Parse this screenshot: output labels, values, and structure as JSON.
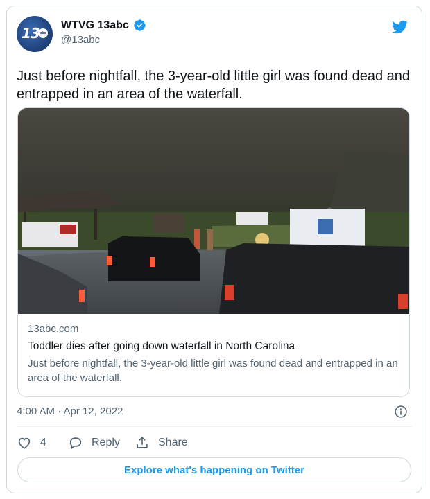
{
  "author": {
    "display_name": "WTVG 13abc",
    "handle": "@13abc",
    "avatar_text": "13",
    "avatar_badge": "abc",
    "verified": true
  },
  "tweet": {
    "text": "Just before nightfall, the 3-year-old little girl was found dead and entrapped in an area of the waterfall.",
    "timestamp": "4:00 AM · Apr 12, 2022"
  },
  "link_card": {
    "domain": "13abc.com",
    "title": "Toddler dies after going down waterfall in North Carolina",
    "description": "Just before nightfall, the 3-year-old little girl was found dead and entrapped in an area of the waterfall."
  },
  "actions": {
    "like_count": "4",
    "reply_label": "Reply",
    "share_label": "Share"
  },
  "explore_label": "Explore what's happening on Twitter",
  "colors": {
    "twitter_blue": "#1d9bf0",
    "text_primary": "#0f1419",
    "text_secondary": "#536471",
    "border": "#cfd9de"
  },
  "icons": [
    "twitter-bird-icon",
    "verified-badge-icon",
    "info-icon",
    "heart-icon",
    "reply-bubble-icon",
    "share-icon"
  ]
}
